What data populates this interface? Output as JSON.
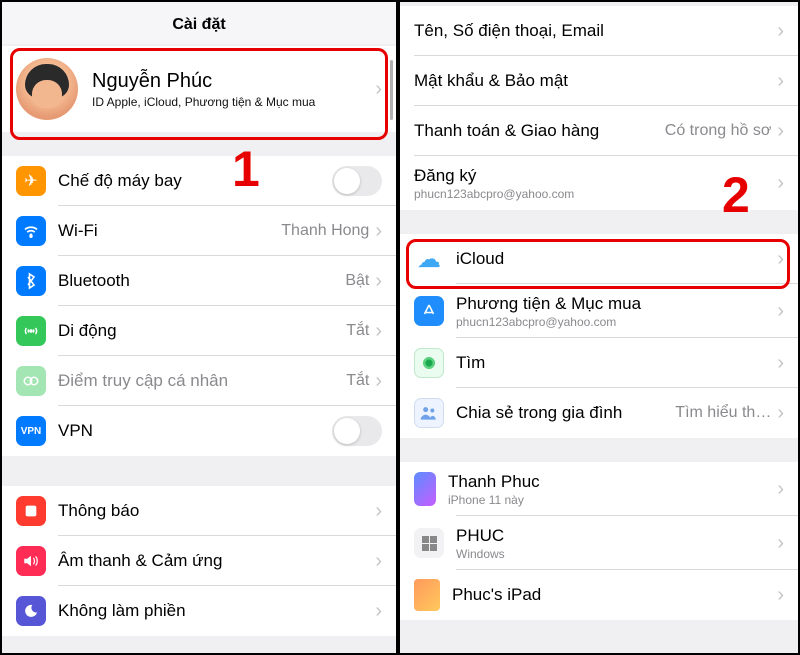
{
  "left": {
    "title": "Cài đặt",
    "profile": {
      "name": "Nguyễn Phúc",
      "sub": "ID Apple, iCloud, Phương tiện & Mục mua"
    },
    "rows1": [
      {
        "label": "Chế độ máy bay",
        "icon": "airplane-icon"
      },
      {
        "label": "Wi-Fi",
        "value": "Thanh Hong",
        "icon": "wifi-icon"
      },
      {
        "label": "Bluetooth",
        "value": "Bật",
        "icon": "bluetooth-icon"
      },
      {
        "label": "Di động",
        "value": "Tắt",
        "icon": "cellular-icon"
      },
      {
        "label": "Điểm truy cập cá nhân",
        "value": "Tắt",
        "icon": "hotspot-icon",
        "dim": true
      },
      {
        "label": "VPN",
        "icon": "vpn-icon"
      }
    ],
    "rows2": [
      {
        "label": "Thông báo",
        "icon": "notif-icon"
      },
      {
        "label": "Âm thanh & Cảm ứng",
        "icon": "sound-icon"
      },
      {
        "label": "Không làm phiền",
        "icon": "dnd-icon"
      }
    ],
    "step": "1"
  },
  "right": {
    "rows1": [
      {
        "label": "Tên, Số điện thoại, Email"
      },
      {
        "label": "Mật khẩu & Bảo mật"
      },
      {
        "label": "Thanh toán & Giao hàng",
        "value": "Có trong hồ sơ"
      },
      {
        "label": "Đăng ký",
        "sub": "phucn123abcpro@yahoo.com"
      }
    ],
    "rows2": [
      {
        "label": "iCloud",
        "icon": "icloud-icon"
      },
      {
        "label": "Phương tiện & Mục mua",
        "sub": "phucn123abcpro@yahoo.com",
        "icon": "appstore-icon"
      },
      {
        "label": "Tìm",
        "icon": "find-icon"
      },
      {
        "label": "Chia sẻ trong gia đình",
        "value": "Tìm hiểu th…",
        "icon": "family-icon"
      }
    ],
    "rows3": [
      {
        "label": "Thanh Phuc",
        "sub": "iPhone 11 này",
        "icon": "phone-icon"
      },
      {
        "label": "PHUC",
        "sub": "Windows",
        "icon": "win-icon"
      },
      {
        "label": "Phuc's iPad",
        "icon": "ipad-icon"
      }
    ],
    "step": "2"
  }
}
